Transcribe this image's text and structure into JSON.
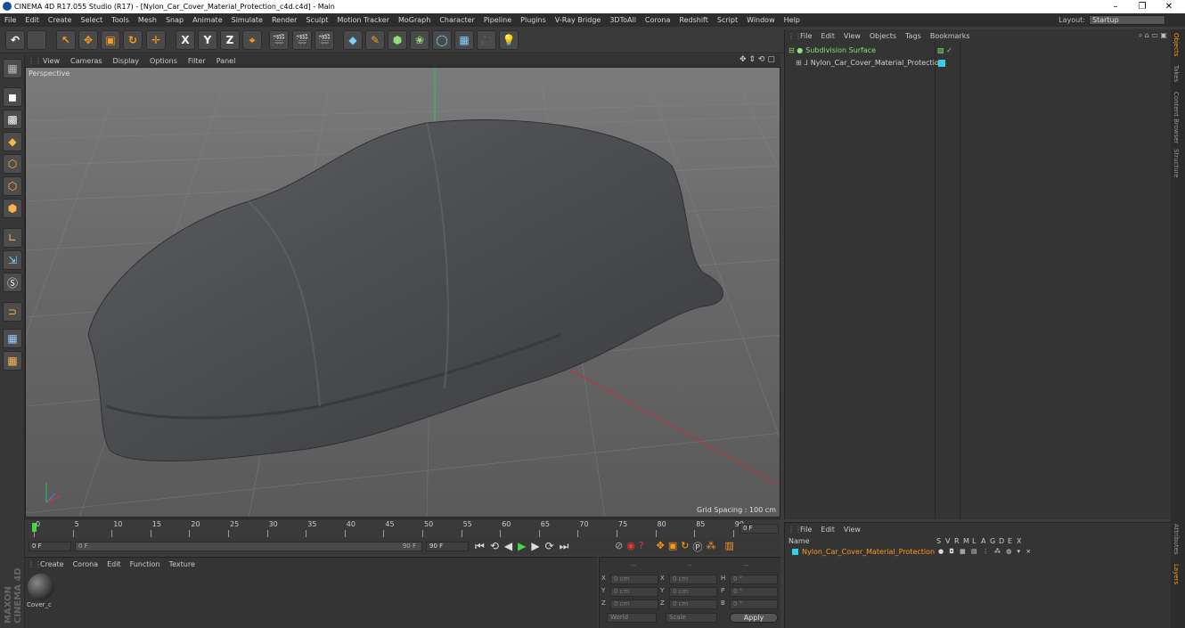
{
  "window": {
    "title": "CINEMA 4D R17.055 Studio (R17) - [Nylon_Car_Cover_Material_Protection_c4d.c4d] - Main",
    "controls": [
      "–",
      "❐",
      "✕"
    ]
  },
  "menu": [
    "File",
    "Edit",
    "Create",
    "Select",
    "Tools",
    "Mesh",
    "Snap",
    "Animate",
    "Simulate",
    "Render",
    "Sculpt",
    "Motion Tracker",
    "MoGraph",
    "Character",
    "Pipeline",
    "Plugins",
    "V-Ray Bridge",
    "3DToAll",
    "Corona",
    "Redshift",
    "Script",
    "Window",
    "Help"
  ],
  "layout": {
    "label": "Layout:",
    "value": "Startup"
  },
  "toolbar": [
    "↶",
    "",
    "↖",
    "✥",
    "▣",
    "↻",
    "✛",
    "X",
    "Y",
    "Z",
    "⌖",
    "🎬",
    "🎬",
    "🎬",
    "◆",
    "✎",
    "⬢",
    "❀",
    "◯",
    "▦",
    "🎥",
    "💡"
  ],
  "viewport": {
    "menu": [
      "View",
      "Cameras",
      "Display",
      "Options",
      "Filter",
      "Panel"
    ],
    "label": "Perspective",
    "grid_spacing": "Grid Spacing : 100 cm"
  },
  "timeline": {
    "ticks": [
      "0",
      "5",
      "10",
      "15",
      "20",
      "25",
      "30",
      "35",
      "40",
      "45",
      "50",
      "55",
      "60",
      "65",
      "70",
      "75",
      "80",
      "85",
      "90"
    ],
    "current_frame": "0 F",
    "start_field": "0 F",
    "slider_start": "0 F",
    "slider_end": "90 F",
    "end_field": "90 F"
  },
  "materials": {
    "menu": [
      "Create",
      "Corona",
      "Edit",
      "Function",
      "Texture"
    ],
    "items": [
      {
        "name": "Cover_c"
      }
    ]
  },
  "coordinates": {
    "header": [
      "--",
      "--",
      "--"
    ],
    "rows": [
      {
        "axis": "X",
        "pos": "0 cm",
        "axis2": "X",
        "size": "0 cm",
        "rot_label": "H",
        "rot": "0 °"
      },
      {
        "axis": "Y",
        "pos": "0 cm",
        "axis2": "Y",
        "size": "0 cm",
        "rot_label": "P",
        "rot": "0 °"
      },
      {
        "axis": "Z",
        "pos": "0 cm",
        "axis2": "Z",
        "size": "0 cm",
        "rot_label": "B",
        "rot": "0 °"
      }
    ],
    "mode": "World",
    "scale": "Scale",
    "apply": "Apply"
  },
  "objects": {
    "menu": [
      "File",
      "Edit",
      "View",
      "Objects",
      "Tags",
      "Bookmarks"
    ],
    "items": [
      {
        "name": "Subdivision Surface",
        "color": "#8de07a"
      },
      {
        "name": "Nylon_Car_Cover_Material_Protection",
        "color": "#bcbcbc"
      }
    ]
  },
  "layers": {
    "menu": [
      "File",
      "Edit",
      "View"
    ],
    "columns": [
      "Name",
      "S",
      "V",
      "R",
      "M",
      "L",
      "A",
      "G",
      "D",
      "E",
      "X"
    ],
    "rows": [
      {
        "name": "Nylon_Car_Cover_Material_Protection",
        "color": "#2fd1e6"
      }
    ]
  },
  "side_tabs": [
    "Objects",
    "Takes",
    "Content Browser",
    "Structure",
    "Attributes",
    "Layers"
  ],
  "brand": "MAXON CINEMA 4D"
}
